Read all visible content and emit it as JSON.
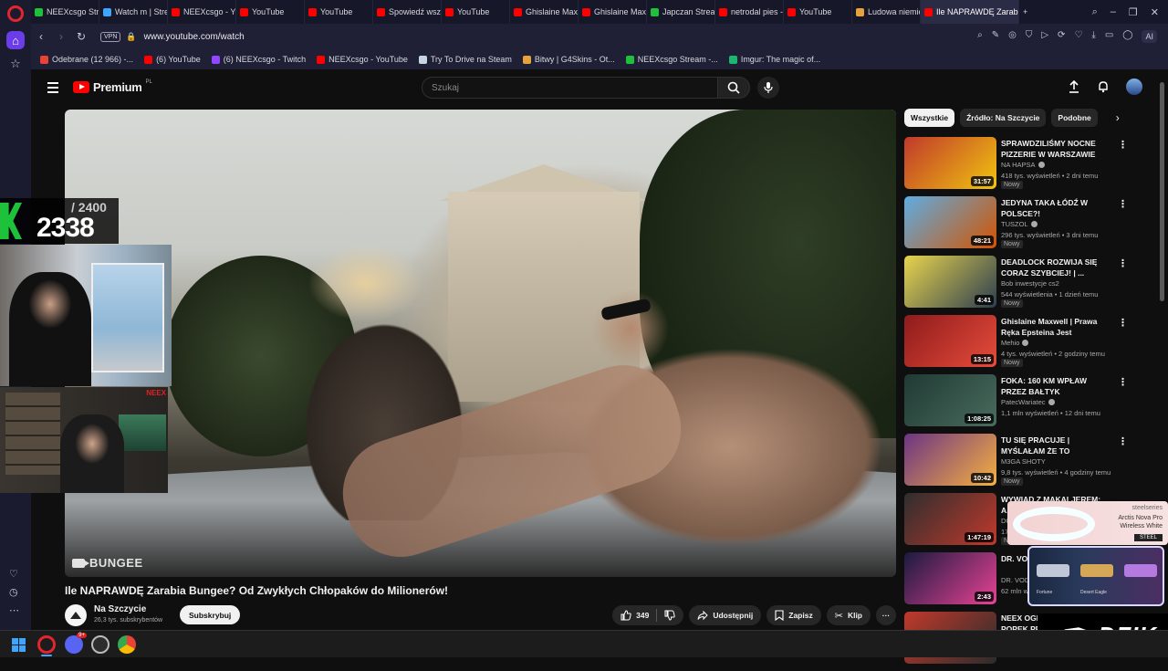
{
  "browser": {
    "tabs": [
      {
        "label": "NEEXcsgo Strea",
        "color": "#1ec23a"
      },
      {
        "label": "Watch m | Strea",
        "color": "#3ea6ff"
      },
      {
        "label": "NEEXcsgo - You",
        "color": "#ff0000"
      },
      {
        "label": "YouTube",
        "color": "#ff0000"
      },
      {
        "label": "YouTube",
        "color": "#ff0000"
      },
      {
        "label": "Spowiedź wszys",
        "color": "#ff0000"
      },
      {
        "label": "YouTube",
        "color": "#ff0000"
      },
      {
        "label": "Ghislaine Maxw",
        "color": "#ff0000"
      },
      {
        "label": "Ghislaine Maxw",
        "color": "#ff0000"
      },
      {
        "label": "Japczan Stream",
        "color": "#1ec23a"
      },
      {
        "label": "netrodal pies -",
        "color": "#ff0000"
      },
      {
        "label": "YouTube",
        "color": "#ff0000"
      },
      {
        "label": "Ludowa niemie",
        "color": "#e8a23a"
      },
      {
        "label": "Ile NAPRAWDĘ Zarabia B",
        "color": "#ff0000",
        "active": true
      }
    ],
    "new_tab": "+",
    "url": "www.youtube.com/watch",
    "vpn": "VPN",
    "ai_label": "AI",
    "bookmarks": [
      {
        "label": "Odebrane (12 966) -...",
        "color": "#ea4335"
      },
      {
        "label": "(6) YouTube",
        "color": "#ff0000"
      },
      {
        "label": "(6) NEEXcsgo - Twitch",
        "color": "#9146ff"
      },
      {
        "label": "NEEXcsgo - YouTube",
        "color": "#ff0000"
      },
      {
        "label": "Try To Drive na Steam",
        "color": "#c7d5e0"
      },
      {
        "label": "Bitwy | G4Skins - Ot...",
        "color": "#e8a23a"
      },
      {
        "label": "NEEXcsgo Stream -...",
        "color": "#1ec23a"
      },
      {
        "label": "Imgur: The magic of...",
        "color": "#1bb76e"
      }
    ]
  },
  "youtube": {
    "logo": "Premium",
    "region": "PL",
    "search_placeholder": "Szukaj"
  },
  "overlay": {
    "max": "/ 2400",
    "value": "2338",
    "cam2_tag": "NEEX"
  },
  "video": {
    "badge": "BUNGEE",
    "title": "Ile NAPRAWDĘ Zarabia Bungee? Od Zwykłych Chłopaków do Milionerów!",
    "channel": "Na Szczycie",
    "subscribers": "26,3 tys. subskrybentów",
    "subscribe": "Subskrybuj",
    "likes": "349",
    "share": "Udostępnij",
    "save": "Zapisz",
    "clip": "Klip",
    "more": "···"
  },
  "chips": [
    "Wszystkie",
    "Źródło: Na Szczycie",
    "Podobne"
  ],
  "recommendations": [
    {
      "title": "SPRAWDZILIŚMY NOCNE PIZZERIE W WARSZAWIE",
      "channel": "NA HAPSA",
      "verified": true,
      "meta": "418 tys. wyświetleń • 2 dni temu",
      "new": "Nowy",
      "duration": "31:57",
      "c1": "#c0392b",
      "c2": "#f1c40f"
    },
    {
      "title": "JEDYNA TAKA ŁÓDŹ W POLSCE?!",
      "channel": "TUSZOL",
      "verified": true,
      "meta": "296 tys. wyświetleń • 3 dni temu",
      "new": "Nowy",
      "duration": "48:21",
      "c1": "#5dade2",
      "c2": "#d35400"
    },
    {
      "title": "DEADLOCK ROZWIJA SIĘ CORAZ SZYBCIEJ! | ...",
      "channel": "Bob inwestycje cs2",
      "verified": false,
      "meta": "544 wyświetlenia • 1 dzień temu",
      "new": "Nowy",
      "duration": "4:41",
      "c1": "#e8d44d",
      "c2": "#2c3e50"
    },
    {
      "title": "Ghislaine Maxwell | Prawa Ręka Epsteina Jest Groźniejsza Niż ...",
      "channel": "Mehio",
      "verified": true,
      "meta": "4 tys. wyświetleń • 2 godziny temu",
      "new": "Nowy",
      "duration": "13:15",
      "c1": "#8e1b1b",
      "c2": "#e74c3c"
    },
    {
      "title": "FOKA: 160 KM WPŁAW PRZEZ BAŁTYK",
      "channel": "PatecWariatec",
      "verified": true,
      "meta": "1,1 mln wyświetleń • 12 dni temu",
      "new": "",
      "duration": "1:08:25",
      "c1": "#1f3a33",
      "c2": "#4a6b5e"
    },
    {
      "title": "TU SIĘ PRACUJE | MYŚLAŁAM ŻE TO NORMALNE | 😂 POLSK...",
      "channel": "M3GA SHOTY",
      "verified": false,
      "meta": "9,8 tys. wyświetleń • 4 godziny temu",
      "new": "Nowy",
      "duration": "10:42",
      "c1": "#6c3483",
      "c2": "#f5b041"
    },
    {
      "title": "WYWIAD Z MAKALJEREM: A...",
      "channel": "DO...",
      "verified": false,
      "meta": "17...",
      "new": "N",
      "duration": "1:47:19",
      "c1": "#2e2e2e",
      "c2": "#c0392b"
    },
    {
      "title": "DR. VOD...",
      "channel": "DR. VOD...",
      "verified": false,
      "meta": "62 mln w...",
      "new": "",
      "duration": "2:43",
      "c1": "#1a1a40",
      "c2": "#e84393"
    },
    {
      "title": "NEEX OGLĄDA WSZELKIE POPEK PR...",
      "channel": "",
      "verified": false,
      "meta": "",
      "new": "",
      "duration": "",
      "c1": "#c0392b",
      "c2": "#2c2c2c"
    }
  ],
  "ads": {
    "ss_brand": "steelseries",
    "ss_product": "Arctis Nova Pro Wireless White",
    "ss_tag": "STEEL",
    "dzik": "DZIK",
    "skin_labels": [
      "Fortune",
      "Desert Eagle"
    ]
  },
  "icons": {
    "menu": "hamburger-icon",
    "search": "search-icon",
    "mic": "mic-icon",
    "upload": "create-icon",
    "bell": "bell-icon",
    "like": "thumbs-up-icon",
    "dislike": "thumbs-down-icon"
  }
}
